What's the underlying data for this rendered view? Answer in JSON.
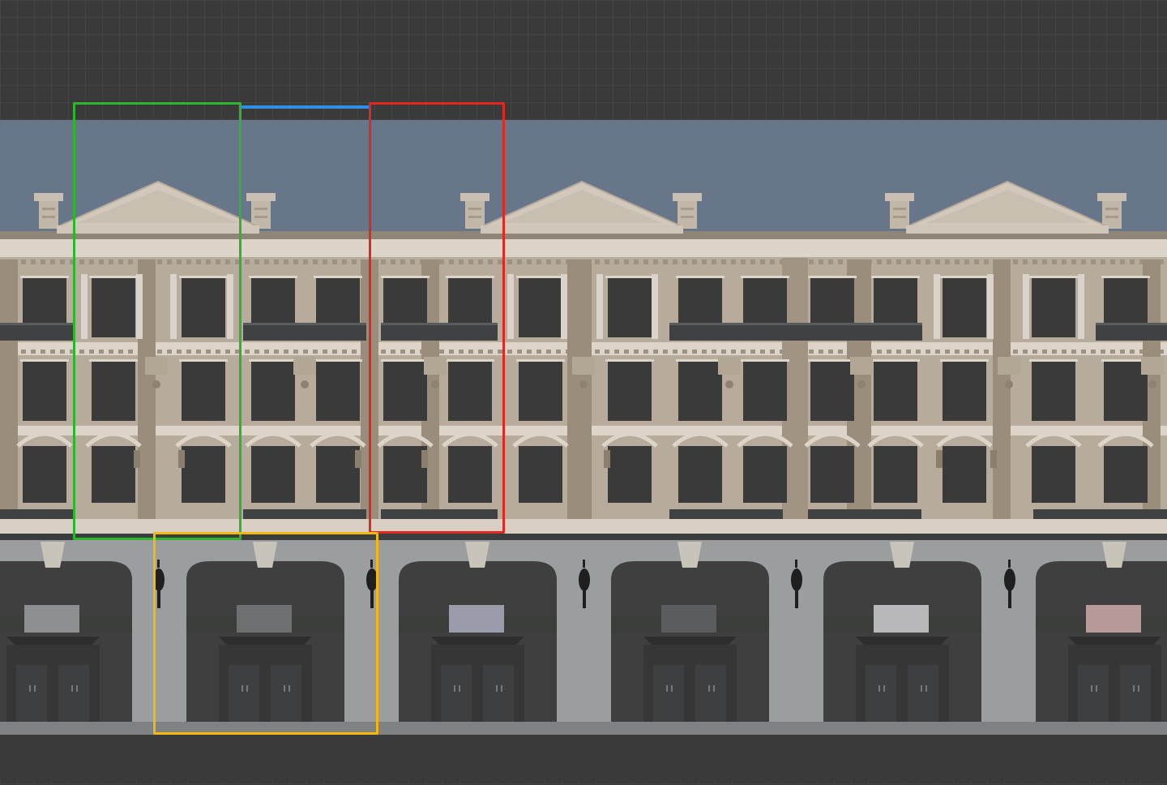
{
  "viewport": {
    "background": "#3a3a3a",
    "grid_color": "#444444"
  },
  "facade": {
    "sky_color": "#68768a",
    "wall_color": "#b7ab9c",
    "trim_color": "#ddd5c9",
    "window_color": "#3a3a3a",
    "pilaster_color": "#9a8d7c",
    "balcony_color": "#3f4143",
    "arcade_color": "#9b9e9e",
    "shop_color": "#3f3f40",
    "ground_color": "#7e8282",
    "sign_colors": [
      "#6d6f71",
      "#9a9cab",
      "#5a5c5e",
      "#b8b8bb",
      "#b89a98",
      "#8d8f91"
    ]
  },
  "selections": [
    {
      "name": "selection-green",
      "color": "#2db52d",
      "module": "upper-bay-a"
    },
    {
      "name": "selection-blue",
      "color": "#2f8fe8",
      "module": "roof-link"
    },
    {
      "name": "selection-red",
      "color": "#e0281e",
      "module": "upper-bay-b"
    },
    {
      "name": "selection-yellow",
      "color": "#f2b80f",
      "module": "arcade-bay"
    }
  ]
}
